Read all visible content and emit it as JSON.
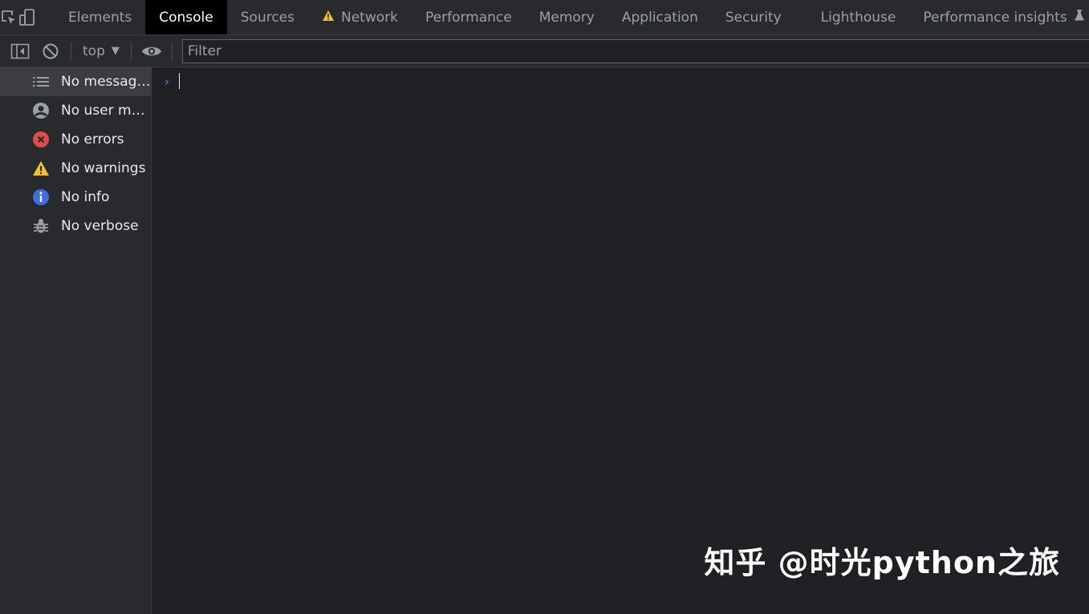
{
  "tabs": [
    {
      "label": "Elements",
      "active": false
    },
    {
      "label": "Console",
      "active": true
    },
    {
      "label": "Sources",
      "active": false
    },
    {
      "label": "Network",
      "active": false,
      "warning": true
    },
    {
      "label": "Performance",
      "active": false
    },
    {
      "label": "Memory",
      "active": false
    },
    {
      "label": "Application",
      "active": false
    },
    {
      "label": "Security",
      "active": false
    },
    {
      "label": "Lighthouse",
      "active": false
    },
    {
      "label": "Performance insights",
      "active": false,
      "experimental": true
    }
  ],
  "toolbar": {
    "context": "top",
    "filter_placeholder": "Filter"
  },
  "sidebar": {
    "items": [
      {
        "label": "No messages",
        "icon": "list-icon",
        "selected": true
      },
      {
        "label": "No user me...",
        "icon": "user-icon",
        "selected": false
      },
      {
        "label": "No errors",
        "icon": "error-icon",
        "selected": false
      },
      {
        "label": "No warnings",
        "icon": "warning-icon",
        "selected": false
      },
      {
        "label": "No info",
        "icon": "info-icon",
        "selected": false
      },
      {
        "label": "No verbose",
        "icon": "bug-icon",
        "selected": false
      }
    ]
  },
  "console": {
    "prompt": "›"
  },
  "watermark": "知乎 @时光python之旅",
  "colors": {
    "background": "#202124",
    "panel": "#292a2d",
    "active_tab": "#000000",
    "error": "#e34a4a",
    "warning": "#f2c12e",
    "info": "#3c6fe0",
    "prompt": "#4a8af4"
  }
}
